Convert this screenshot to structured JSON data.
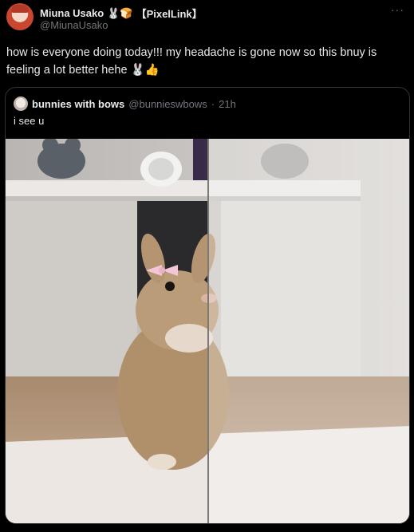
{
  "post": {
    "author_name": "Miuna Usako",
    "author_emojis": "🐰🍞",
    "author_tag": "【PixelLink】",
    "handle": "@MiunaUsako",
    "more_icon": "ellipsis-icon",
    "text": "how is everyone doing today!!! my headache is gone now so this bnuy is feeling a lot better hehe 🐰👍"
  },
  "quote": {
    "author_name": "bunnies with bows",
    "handle": "@bunnieswbows",
    "separator": "·",
    "time": "21h",
    "text": "i see u",
    "image_subject": "bunny-photo"
  },
  "colors": {
    "background": "#000000",
    "text": "#e7e9ea",
    "muted": "#71767b",
    "border": "#2f3336"
  }
}
